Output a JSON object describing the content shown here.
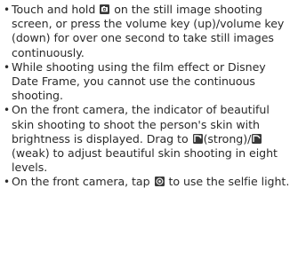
{
  "bullet_char": "•",
  "notes": [
    {
      "parts": [
        "Touch and hold ",
        " on the still image shooting screen, or press the volume key (up)/volume key (down) for over one second to take still images continuously."
      ],
      "icon": "burst-shutter-icon"
    },
    {
      "text": "While shooting using the film effect or Disney Date Frame, you cannot use the continuous shooting."
    },
    {
      "parts": [
        "On the front camera, the indicator of beautiful skin shooting to shoot the person's skin with brightness is displayed. Drag to ",
        "(strong)/",
        "(weak) to adjust beautiful skin shooting in eight levels."
      ],
      "icons": [
        "skin-strong-icon",
        "skin-weak-icon"
      ]
    },
    {
      "parts": [
        "On the front camera, tap ",
        " to use the selfie light."
      ],
      "icon": "selfie-light-icon"
    }
  ],
  "colors": {
    "text": "#2a2a2a",
    "icon_fill": "#3a3a3a"
  }
}
